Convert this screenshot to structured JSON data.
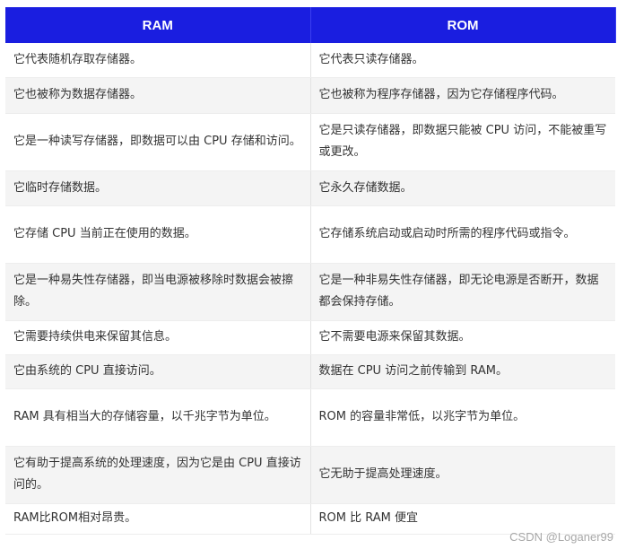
{
  "table": {
    "headers": [
      "RAM",
      "ROM"
    ],
    "rows": [
      [
        "它代表随机存取存储器。",
        "它代表只读存储器。"
      ],
      [
        "它也被称为数据存储器。",
        "它也被称为程序存储器，因为它存储程序代码。"
      ],
      [
        "它是一种读写存储器，即数据可以由 CPU 存储和访问。",
        "它是只读存储器，即数据只能被 CPU 访问，不能被重写或更改。"
      ],
      [
        "它临时存储数据。",
        "它永久存储数据。"
      ],
      [
        "它存储 CPU 当前正在使用的数据。",
        "它存储系统启动或启动时所需的程序代码或指令。"
      ],
      [
        "它是一种易失性存储器，即当电源被移除时数据会被擦除。",
        "它是一种非易失性存储器，即无论电源是否断开，数据都会保持存储。"
      ],
      [
        "它需要持续供电来保留其信息。",
        "它不需要电源来保留其数据。"
      ],
      [
        "它由系统的 CPU 直接访问。",
        "数据在 CPU 访问之前传输到 RAM。"
      ],
      [
        "RAM 具有相当大的存储容量，以千兆字节为单位。",
        "ROM 的容量非常低，以兆字节为单位。"
      ],
      [
        "它有助于提高系统的处理速度，因为它是由 CPU 直接访问的。",
        "它无助于提高处理速度。"
      ],
      [
        "RAM比ROM相对昂贵。",
        "ROM 比 RAM 便宜"
      ]
    ]
  },
  "watermark": "CSDN @Loganer99",
  "colors": {
    "header_bg": "#1a1ee0",
    "header_text": "#ffffff",
    "row_alt": "#f4f4f4"
  }
}
